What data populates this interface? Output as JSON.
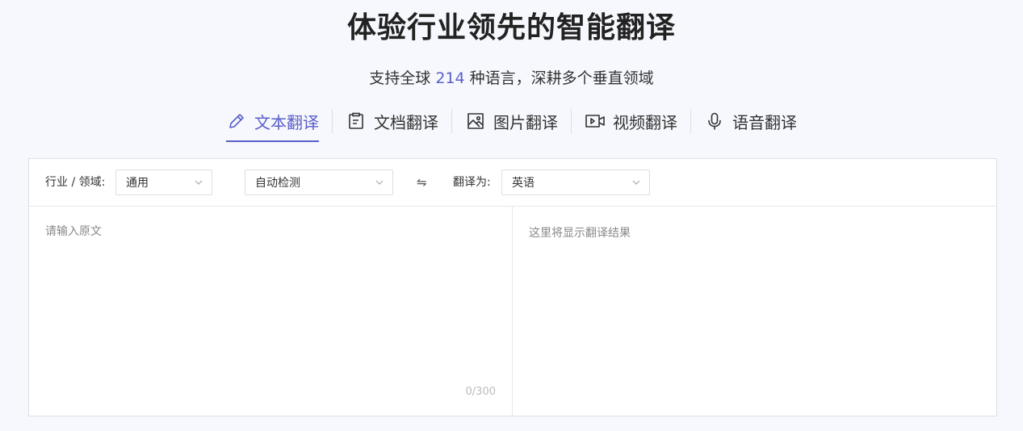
{
  "header": {
    "title": "体验行业领先的智能翻译",
    "subtitle_prefix": "支持全球",
    "language_count": "214",
    "subtitle_suffix": "种语言，深耕多个垂直领域"
  },
  "tabs": [
    {
      "label": "文本翻译",
      "icon": "pencil-icon",
      "active": true
    },
    {
      "label": "文档翻译",
      "icon": "document-icon",
      "active": false
    },
    {
      "label": "图片翻译",
      "icon": "image-icon",
      "active": false
    },
    {
      "label": "视频翻译",
      "icon": "video-icon",
      "active": false
    },
    {
      "label": "语音翻译",
      "icon": "microphone-icon",
      "active": false
    }
  ],
  "toolbar": {
    "domain_label": "行业 / 领域:",
    "domain_value": "通用",
    "source_lang_value": "自动检测",
    "swap_symbol": "⇋",
    "target_label": "翻译为:",
    "target_lang_value": "英语"
  },
  "editor": {
    "source_placeholder": "请输入原文",
    "counter": "0/300",
    "result_placeholder": "这里将显示翻译结果"
  },
  "colors": {
    "accent": "#5b5fc7",
    "background": "#f6f8fd",
    "border": "#dcdfe6"
  }
}
